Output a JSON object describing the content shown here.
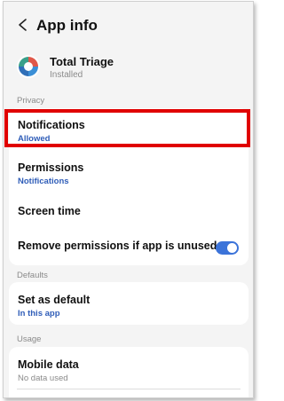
{
  "header": {
    "title": "App info"
  },
  "app": {
    "name": "Total Triage",
    "status": "Installed"
  },
  "sections": {
    "privacy": "Privacy",
    "defaults": "Defaults",
    "usage": "Usage"
  },
  "privacy_items": {
    "notifications": {
      "title": "Notifications",
      "subtitle": "Allowed"
    },
    "permissions": {
      "title": "Permissions",
      "subtitle": "Notifications"
    },
    "screen_time": {
      "title": "Screen time"
    },
    "remove_permissions": {
      "title": "Remove permissions if app is unused",
      "toggle_on": true
    }
  },
  "defaults_items": {
    "set_default": {
      "title": "Set as default",
      "subtitle": "In this app"
    }
  },
  "usage_items": {
    "mobile_data": {
      "title": "Mobile data",
      "subtitle": "No data used"
    }
  },
  "colors": {
    "accent": "#3b73d9",
    "subtitle_link": "#2f5db8",
    "highlight": "#e00000"
  }
}
